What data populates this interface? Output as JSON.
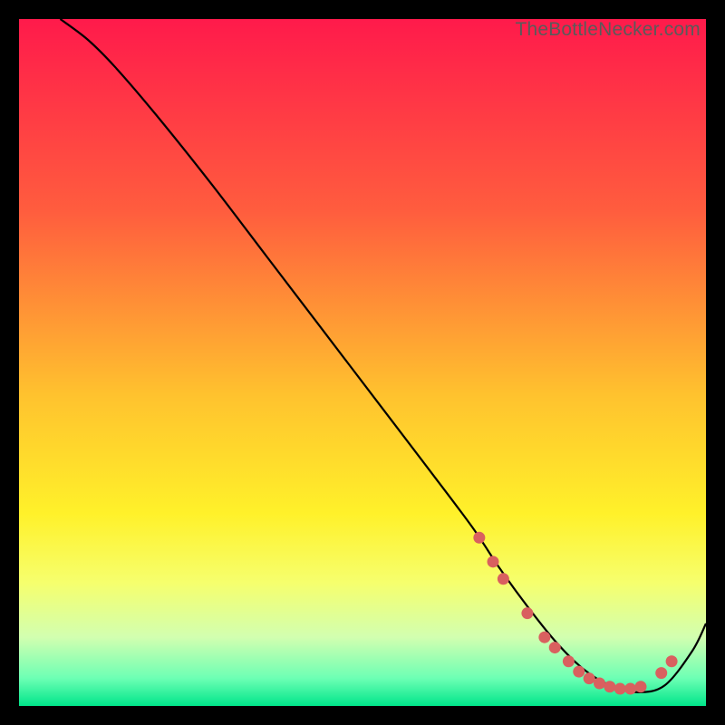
{
  "watermark": "TheBottleNecker.com",
  "chart_data": {
    "type": "line",
    "title": "",
    "xlabel": "",
    "ylabel": "",
    "xlim": [
      0,
      100
    ],
    "ylim": [
      0,
      100
    ],
    "gradient_stops": [
      {
        "offset": 0,
        "color": "#ff1a4b"
      },
      {
        "offset": 28,
        "color": "#ff5d3e"
      },
      {
        "offset": 55,
        "color": "#ffc32e"
      },
      {
        "offset": 72,
        "color": "#fff12a"
      },
      {
        "offset": 82,
        "color": "#f6ff6d"
      },
      {
        "offset": 90,
        "color": "#d2ffb0"
      },
      {
        "offset": 96,
        "color": "#6cffb4"
      },
      {
        "offset": 100,
        "color": "#00e58a"
      }
    ],
    "series": [
      {
        "name": "bottleneck-curve",
        "x": [
          6,
          10,
          14,
          20,
          28,
          36,
          44,
          52,
          60,
          66,
          70,
          74,
          78,
          82,
          86,
          90,
          94,
          98,
          100
        ],
        "y": [
          100,
          97,
          93,
          86,
          76,
          65.5,
          55,
          44.5,
          34,
          26,
          20,
          14.5,
          9.5,
          5.5,
          3,
          2,
          3,
          8,
          12
        ]
      }
    ],
    "markers": {
      "name": "highlight-dots",
      "color": "#d9605f",
      "points": [
        {
          "x": 67,
          "y": 24.5
        },
        {
          "x": 69,
          "y": 21
        },
        {
          "x": 70.5,
          "y": 18.5
        },
        {
          "x": 74,
          "y": 13.5
        },
        {
          "x": 76.5,
          "y": 10
        },
        {
          "x": 78,
          "y": 8.5
        },
        {
          "x": 80,
          "y": 6.5
        },
        {
          "x": 81.5,
          "y": 5
        },
        {
          "x": 83,
          "y": 4
        },
        {
          "x": 84.5,
          "y": 3.3
        },
        {
          "x": 86,
          "y": 2.8
        },
        {
          "x": 87.5,
          "y": 2.5
        },
        {
          "x": 89,
          "y": 2.5
        },
        {
          "x": 90.5,
          "y": 2.8
        },
        {
          "x": 93.5,
          "y": 4.8
        },
        {
          "x": 95,
          "y": 6.5
        }
      ]
    }
  }
}
